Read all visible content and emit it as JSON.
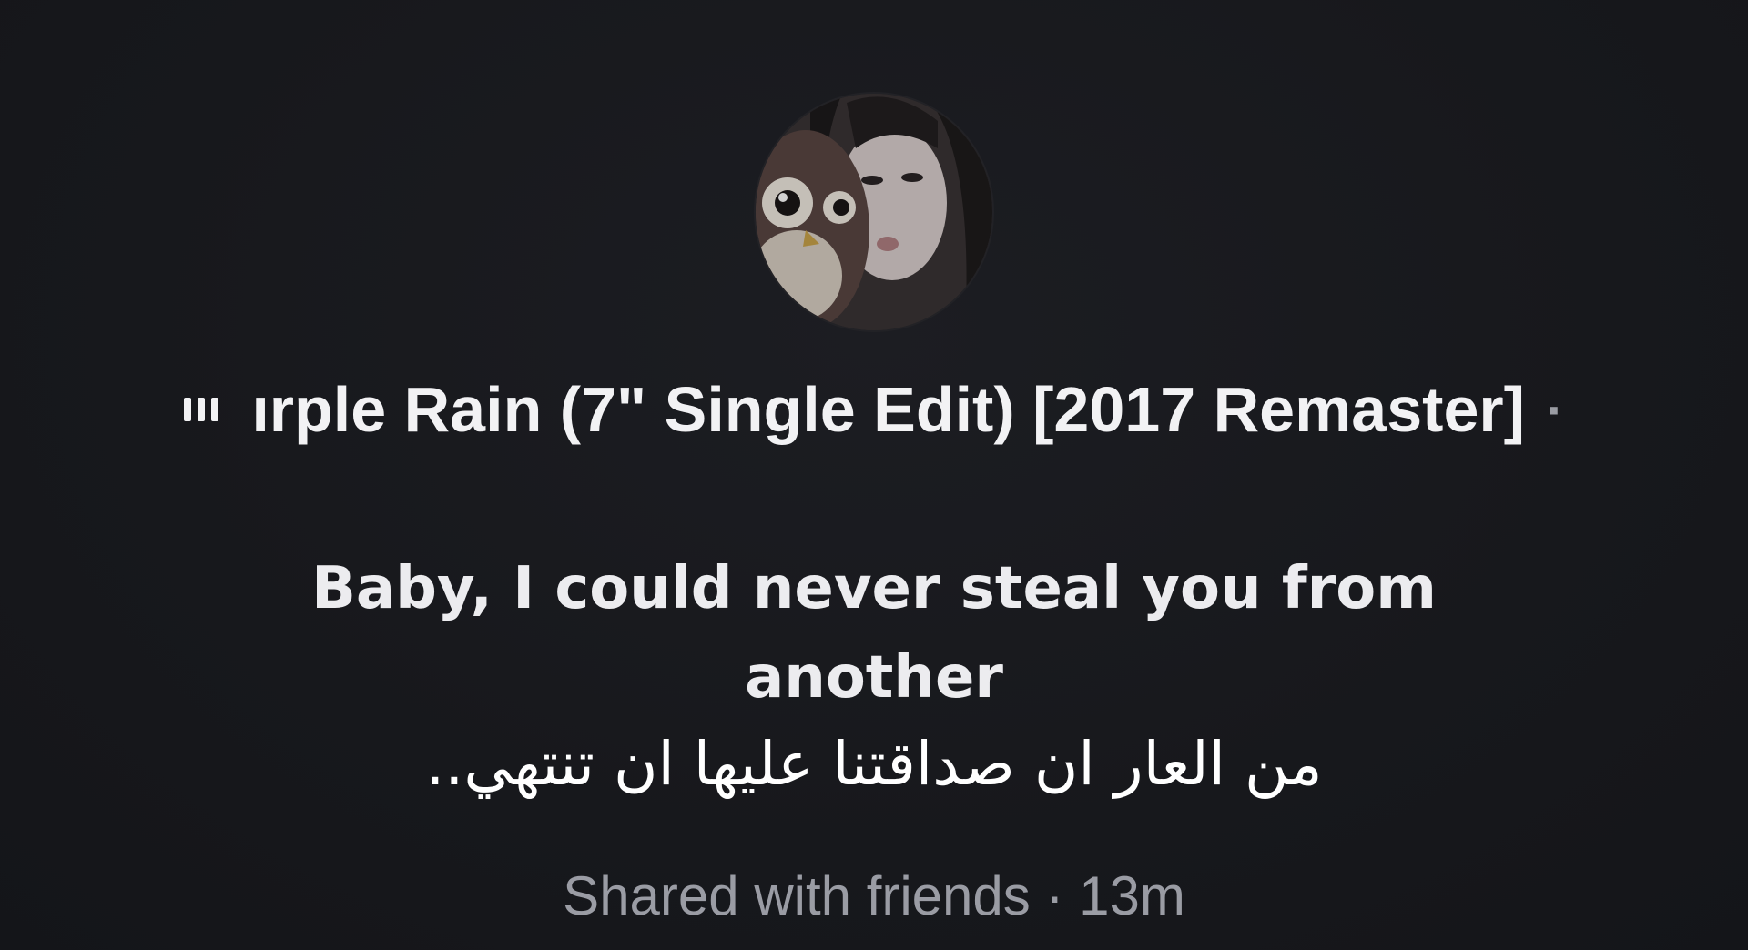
{
  "now_playing": {
    "icon": "playing-bars-icon",
    "track": "ırple Rain (7\" Single Edit) [2017 Remaster]",
    "separator": "·"
  },
  "lyric": {
    "text": "Baby, I could never steal you from another"
  },
  "caption": {
    "text": "من العار ان صداقتنا عليها ان تنتهي.."
  },
  "footer": {
    "text": "Shared with friends · 13m"
  },
  "colors": {
    "background": "#17181c",
    "primary_text": "#f2f2f4",
    "secondary_text": "#9a9ca4"
  }
}
